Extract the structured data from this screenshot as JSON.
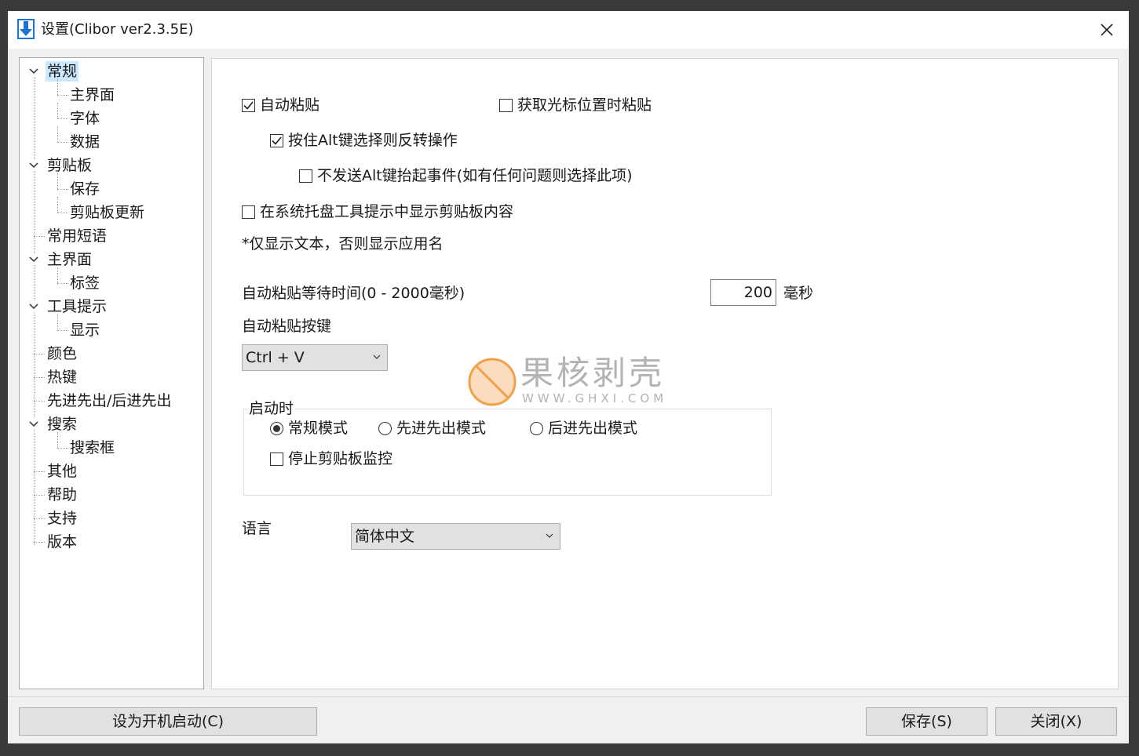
{
  "window": {
    "title": "设置(Clibor ver2.3.5E)"
  },
  "nav": {
    "items": [
      {
        "label": "常规",
        "level": 0,
        "expanded": true,
        "selected": true
      },
      {
        "label": "主界面",
        "level": 1
      },
      {
        "label": "字体",
        "level": 1
      },
      {
        "label": "数据",
        "level": 1
      },
      {
        "label": "剪贴板",
        "level": 0,
        "expanded": true
      },
      {
        "label": "保存",
        "level": 1
      },
      {
        "label": "剪贴板更新",
        "level": 1
      },
      {
        "label": "常用短语",
        "level": 0
      },
      {
        "label": "主界面",
        "level": 0,
        "expanded": true
      },
      {
        "label": "标签",
        "level": 1
      },
      {
        "label": "工具提示",
        "level": 0,
        "expanded": true
      },
      {
        "label": "显示",
        "level": 1
      },
      {
        "label": "颜色",
        "level": 0
      },
      {
        "label": "热键",
        "level": 0
      },
      {
        "label": "先进先出/后进先出",
        "level": 0
      },
      {
        "label": "搜索",
        "level": 0,
        "expanded": true
      },
      {
        "label": "搜索框",
        "level": 1
      },
      {
        "label": "其他",
        "level": 0
      },
      {
        "label": "帮助",
        "level": 0
      },
      {
        "label": "支持",
        "level": 0
      },
      {
        "label": "版本",
        "level": 0
      }
    ]
  },
  "general": {
    "auto_paste": {
      "label": "自动粘贴",
      "checked": true
    },
    "paste_on_cursor": {
      "label": "获取光标位置时粘贴",
      "checked": false
    },
    "alt_reverse": {
      "label": "按住Alt键选择则反转操作",
      "checked": true
    },
    "no_alt_keyup": {
      "label": "不发送Alt键抬起事件(如有任何问题则选择此项)",
      "checked": false
    },
    "tray_tooltip": {
      "label": "在系统托盘工具提示中显示剪贴板内容",
      "checked": false
    },
    "tray_note": "*仅显示文本，否则显示应用名",
    "wait_time_label": "自动粘贴等待时间(0 - 2000毫秒)",
    "wait_time_value": "200",
    "wait_time_unit": "毫秒",
    "paste_key_label": "自动粘贴按键",
    "paste_key_value": "Ctrl + V",
    "startup": {
      "title": "启动时",
      "mode_normal": {
        "label": "常规模式",
        "selected": true
      },
      "mode_fifo": {
        "label": "先进先出模式",
        "selected": false
      },
      "mode_lifo": {
        "label": "后进先出模式",
        "selected": false
      },
      "stop_monitor": {
        "label": "停止剪贴板监控",
        "checked": false
      }
    },
    "language_label": "语言",
    "language_value": "简体中文"
  },
  "watermark": {
    "text": "果核剥壳",
    "sub": "WWW.GHXI.COM"
  },
  "footer": {
    "startup_button": "设为开机启动(C)",
    "save_button": "保存(S)",
    "close_button": "关闭(X)"
  },
  "colors": {
    "selection": "#cce8ff",
    "accent_icon": "#1e73d2",
    "watermark_orange": "#f2a14a"
  }
}
